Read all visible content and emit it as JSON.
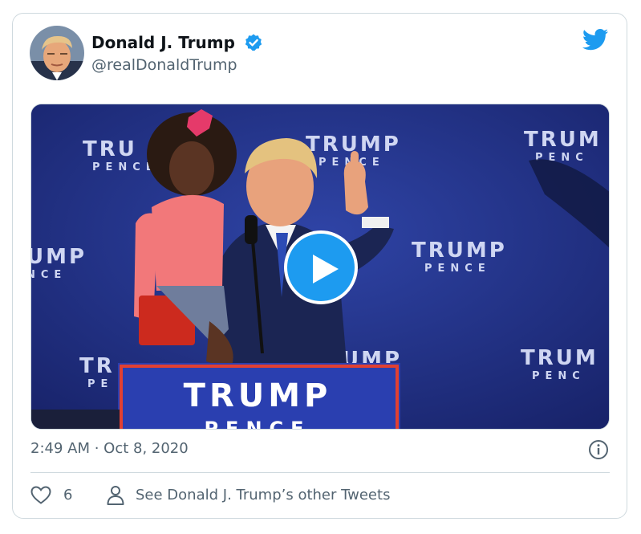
{
  "tweet": {
    "author_name": "Donald J. Trump",
    "author_handle": "@realDonaldTrump",
    "verified": true,
    "timestamp": "2:49 AM · Oct 8, 2020",
    "like_count": "6",
    "other_tweets_label": "See Donald J. Trump’s other Tweets"
  },
  "media": {
    "type": "video",
    "backdrop_words": [
      "TRUMP",
      "PENCE"
    ],
    "podium_line1": "TRUMP",
    "podium_line2": "PENCE"
  },
  "icons": {
    "verified": "verified-badge-icon",
    "platform": "twitter-bird-icon",
    "play": "play-icon",
    "info": "info-icon",
    "like": "heart-icon",
    "profile": "person-icon"
  },
  "colors": {
    "brand": "#1d9bf0",
    "text_primary": "#0f1419",
    "text_secondary": "#536471",
    "border": "#cfd9de",
    "backdrop": "#22307a"
  }
}
